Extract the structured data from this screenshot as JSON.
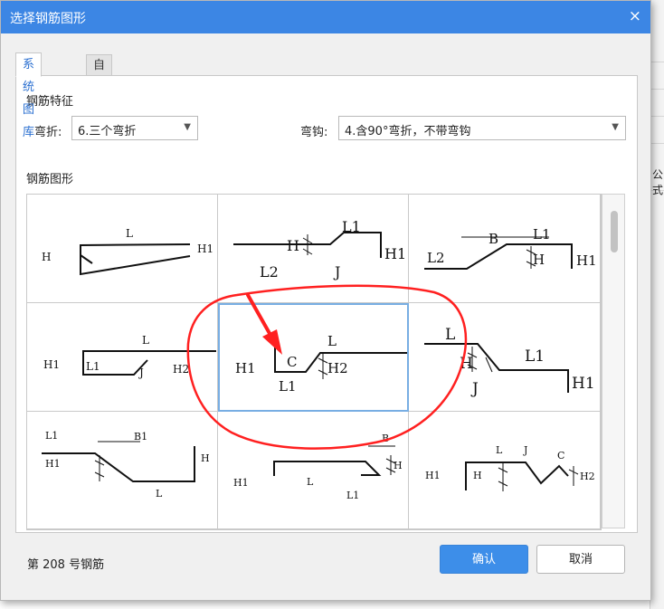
{
  "window": {
    "title": "选择钢筋图形",
    "close": "×"
  },
  "tabs": [
    {
      "label": "系统图库"
    },
    {
      "label": "自定义图库"
    }
  ],
  "features": {
    "heading": "钢筋特征",
    "bend_label": "弯折:",
    "bend_value": "6.三个弯折",
    "hook_label": "弯钩:",
    "hook_value": "4.含90°弯折，不带弯钩"
  },
  "shapes": {
    "heading": "钢筋图形",
    "cells": [
      {
        "labels": [
          "H",
          "L",
          "H1"
        ]
      },
      {
        "labels": [
          "H",
          "L1",
          "H1",
          "L2",
          "J"
        ]
      },
      {
        "labels": [
          "B",
          "L1",
          "L2",
          "H",
          "H1"
        ]
      },
      {
        "labels": [
          "H1",
          "L",
          "L1",
          "J",
          "H2"
        ]
      },
      {
        "labels": [
          "H1",
          "C",
          "L",
          "H2",
          "L1"
        ]
      },
      {
        "labels": [
          "L",
          "H",
          "L1",
          "J",
          "H1"
        ]
      },
      {
        "labels": [
          "L1",
          "B1",
          "H1",
          "H",
          "L"
        ]
      },
      {
        "labels": [
          "H1",
          "B",
          "L",
          "H",
          "L1"
        ]
      },
      {
        "labels": [
          "L",
          "J",
          "C",
          "H1",
          "H",
          "H2"
        ]
      }
    ]
  },
  "background": {
    "partial_text": "公式"
  },
  "status": {
    "text": "第 208 号钢筋"
  },
  "buttons": {
    "ok": "确认",
    "cancel": "取消"
  },
  "colors": {
    "titlebar": "#3c86e4",
    "primary_button": "#3d8ee9",
    "selection": "#78aee3",
    "annotation": "#ff2020"
  }
}
